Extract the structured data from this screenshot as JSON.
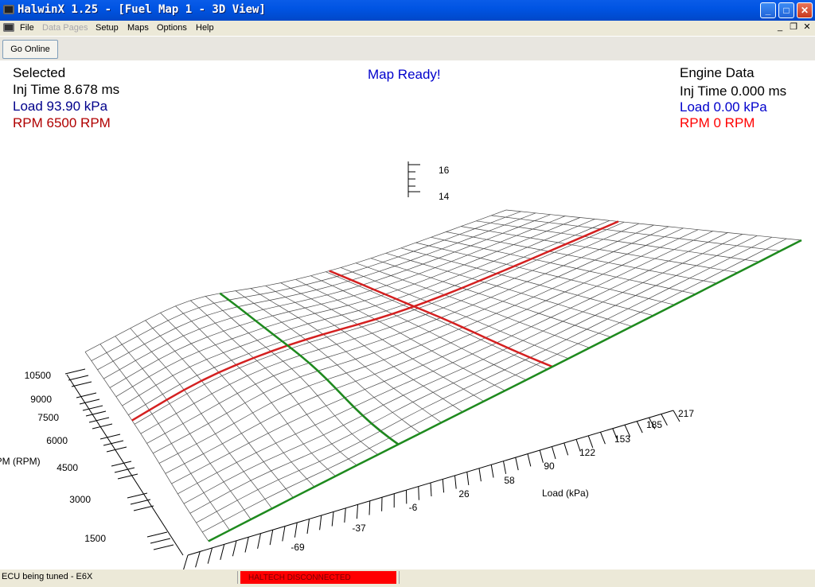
{
  "window": {
    "title": "HalwinX 1.25 - [Fuel Map 1 - 3D View]",
    "controls": {
      "minimize": "_",
      "maximize": "□",
      "close": "✕"
    },
    "icon": "app-icon"
  },
  "menu": {
    "items": [
      {
        "label": "File",
        "disabled": false
      },
      {
        "label": "Data Pages",
        "disabled": true
      },
      {
        "label": "Setup",
        "disabled": false
      },
      {
        "label": "Maps",
        "disabled": false
      },
      {
        "label": "Options",
        "disabled": false
      },
      {
        "label": "Help",
        "disabled": false
      }
    ],
    "mdi": {
      "minimize": "_",
      "restore": "❐",
      "close": "✕"
    }
  },
  "toolbar": {
    "go_online_label": "Go Online"
  },
  "selected": {
    "title": "Selected",
    "inj_time": "Inj Time 8.678 ms",
    "load": "Load 93.90 kPa",
    "rpm": "RPM 6500 RPM"
  },
  "engine_data": {
    "title": "Engine Data",
    "inj_time": "Inj Time 0.000 ms",
    "load": "Load 0.00 kPa",
    "rpm": "RPM 0 RPM"
  },
  "status_message": "Map Ready!",
  "plot": {
    "z_ticks": [
      "16",
      "14"
    ],
    "rpm_ticks": [
      "10500",
      "9000",
      "7500",
      "6000",
      "4500",
      "3000",
      "1500"
    ],
    "rpm_axis_label": "RPM (RPM)",
    "load_ticks": [
      "217",
      "185",
      "153",
      "122",
      "90",
      "58",
      "26",
      "-6",
      "-37",
      "-69"
    ],
    "load_axis_label": "Load (kPa)"
  },
  "statusbar": {
    "ecu_text": "ECU being tuned - E6X",
    "connection_text": "HALTECH DISCONNECTED"
  },
  "colors": {
    "selected_load": "#00008b",
    "selected_rpm": "#b00000",
    "status_message": "#0000cc",
    "engine_load": "#0000cc",
    "engine_rpm": "#ff0000",
    "selected_line": "#d42020",
    "engine_line": "#1e8a1e",
    "connection_bg": "#ff0000"
  }
}
